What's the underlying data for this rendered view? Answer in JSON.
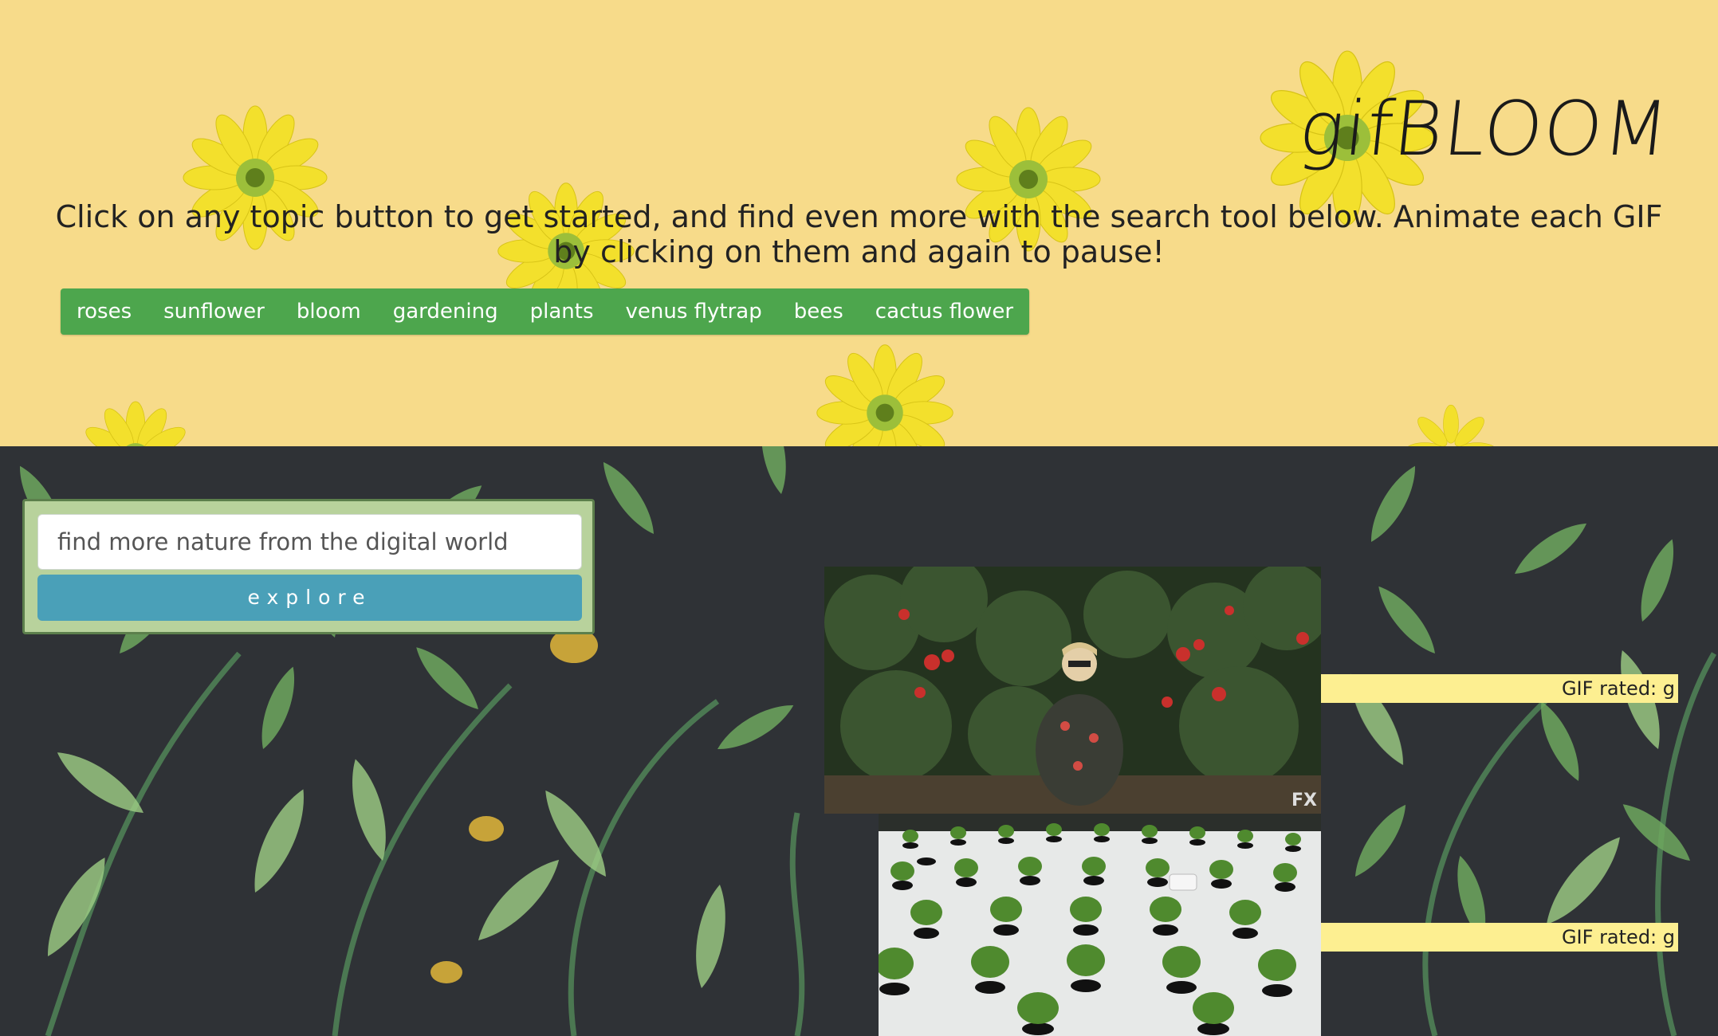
{
  "app": {
    "logo": "gifBLOOM"
  },
  "header": {
    "intro": "Click on any topic button to get started, and find even more with the search tool below. Animate each GIF by clicking on them and again to pause!",
    "topics": [
      "roses",
      "sunflower",
      "bloom",
      "gardening",
      "plants",
      "venus flytrap",
      "bees",
      "cactus flower"
    ]
  },
  "search": {
    "placeholder": "find more nature from the digital world",
    "button_label": "explore"
  },
  "gifs": [
    {
      "rating_label": "GIF rated: g",
      "watermark": "FX"
    },
    {
      "rating_label": "GIF rated: g"
    }
  ],
  "colors": {
    "header_bg": "#f7db8a",
    "topic_bar": "#4da64d",
    "explore_button": "#4aa0b8",
    "search_panel": "#b8d29c",
    "rating_bg": "#fdef91"
  }
}
